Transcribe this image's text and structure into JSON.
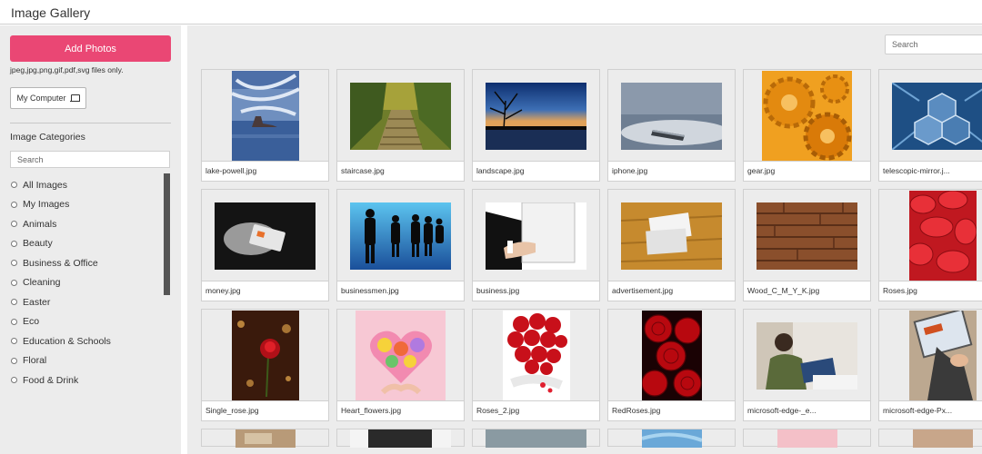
{
  "app": {
    "title": "Image Gallery"
  },
  "sidebar": {
    "add_photos_label": "Add Photos",
    "file_types_note": "jpeg,jpg,png,gif,pdf,svg files only.",
    "my_computer_label": "My Computer",
    "categories_title": "Image Categories",
    "category_search_placeholder": "Search",
    "categories": [
      {
        "label": "All Images"
      },
      {
        "label": "My Images"
      },
      {
        "label": "Animals"
      },
      {
        "label": "Beauty"
      },
      {
        "label": "Business & Office"
      },
      {
        "label": "Cleaning"
      },
      {
        "label": "Easter"
      },
      {
        "label": "Eco"
      },
      {
        "label": "Education & Schools"
      },
      {
        "label": "Floral"
      },
      {
        "label": "Food & Drink"
      }
    ]
  },
  "gallery": {
    "search_placeholder": "Search",
    "images": [
      {
        "name": "lake-powell.jpg"
      },
      {
        "name": "staircase.jpg"
      },
      {
        "name": "landscape.jpg"
      },
      {
        "name": "iphone.jpg"
      },
      {
        "name": "gear.jpg"
      },
      {
        "name": "telescopic-mirror.j..."
      },
      {
        "name": "money.jpg"
      },
      {
        "name": "businessmen.jpg"
      },
      {
        "name": "business.jpg"
      },
      {
        "name": "advertisement.jpg"
      },
      {
        "name": "Wood_C_M_Y_K.jpg"
      },
      {
        "name": "Roses.jpg"
      },
      {
        "name": "Single_rose.jpg"
      },
      {
        "name": "Heart_flowers.jpg"
      },
      {
        "name": "Roses_2.jpg"
      },
      {
        "name": "RedRoses.jpg"
      },
      {
        "name": "microsoft-edge-_e..."
      },
      {
        "name": "microsoft-edge-Px..."
      }
    ]
  },
  "colors": {
    "accent": "#ea4774",
    "panel_bg": "#ececec",
    "scrollbar": "#555555"
  }
}
